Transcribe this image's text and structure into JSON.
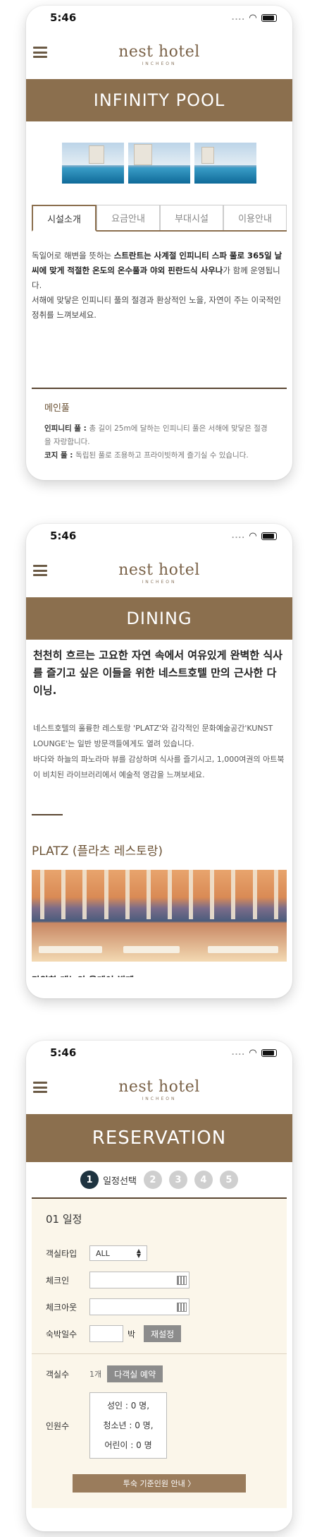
{
  "colors": {
    "brand_brown": "#8b6f4e",
    "dark_rule": "#5a4632",
    "step_active": "#1e3340",
    "step_inactive": "#cfcfcf",
    "panel_bg": "#fbf6ea"
  },
  "status_bar": {
    "time": "5:46",
    "signal": "....",
    "wifi_icon": "wifi-icon",
    "battery_icon": "battery-icon"
  },
  "logo": {
    "main": "nest hotel",
    "sub": "INCHEON"
  },
  "pool_screen": {
    "banner": "INFINITY POOL",
    "tabs": [
      "시설소개",
      "요금안내",
      "부대시설",
      "이용안내"
    ],
    "desc_1a": "독일어로 해변을 뜻하는 ",
    "desc_1b": "스트란트는 사계절 인피니티 스파 풀로 365일 날씨에 맞게 적절한 온도의 온수풀과 야외 핀란드식 사우나",
    "desc_1c": "가 함께 운영됩니다.",
    "desc_2": "서해에 맞닿은 인피니티 풀의 절경과 환상적인 노을, 자연이 주는 이국적인 정취를 느껴보세요.",
    "main_pool_title": "메인풀",
    "item_1_label": "인피니티 풀 : ",
    "item_1_text": "총 길이 25m에 달하는 인피니티 풀은 서해에 맞닿은 절경을 자랑합니다.",
    "item_2_label": "코지 풀 : ",
    "item_2_text": "독립된 풀로 조용하고 프라이빗하게 즐기실 수 있습니다."
  },
  "dining_screen": {
    "banner": "DINING",
    "headline": "천천히 흐르는 고요한 자연 속에서 여유있게 완벽한 식사를 즐기고 싶은 이들을 위한 네스트호텔 만의 근사한 다이닝.",
    "desc_1": "네스트호텔의 훌륭한 레스토랑 'PLATZ'와 감각적인 문화예술공간'KUNST LOUNGE'는 일반 방문객들에게도 열려 있습니다.",
    "desc_2": "바다와 하늘의 파노라마 뷰를 감상하며 식사를 즐기시고, 1,000여권의 아트북이 비치된 라이브러리에서 예술적 영감을 느껴보세요.",
    "section_title": "PLATZ (플라츠 레스토랑)",
    "cutoff_text": "다양한 메뉴의 올데이 뷔페"
  },
  "reservation_screen": {
    "banner": "RESERVATION",
    "steps": [
      "1",
      "2",
      "3",
      "4",
      "5"
    ],
    "active_step_label": "일정선택",
    "section_title": "01 일정",
    "room_type_label": "객실타입",
    "room_type_value": "ALL",
    "checkin_label": "체크인",
    "checkout_label": "체크아웃",
    "nights_label": "숙박일수",
    "nights_unit": "박",
    "reset_button": "재설정",
    "rooms_label": "객실수",
    "rooms_value": "1개",
    "multi_room_button": "다객실 예약",
    "guests_label": "인원수",
    "adults": "성인 : 0 명,",
    "teens": "청소년 : 0 명,",
    "children": "어린이 : 0 명",
    "guide_button": "투숙 기준인원 안내 〉"
  }
}
